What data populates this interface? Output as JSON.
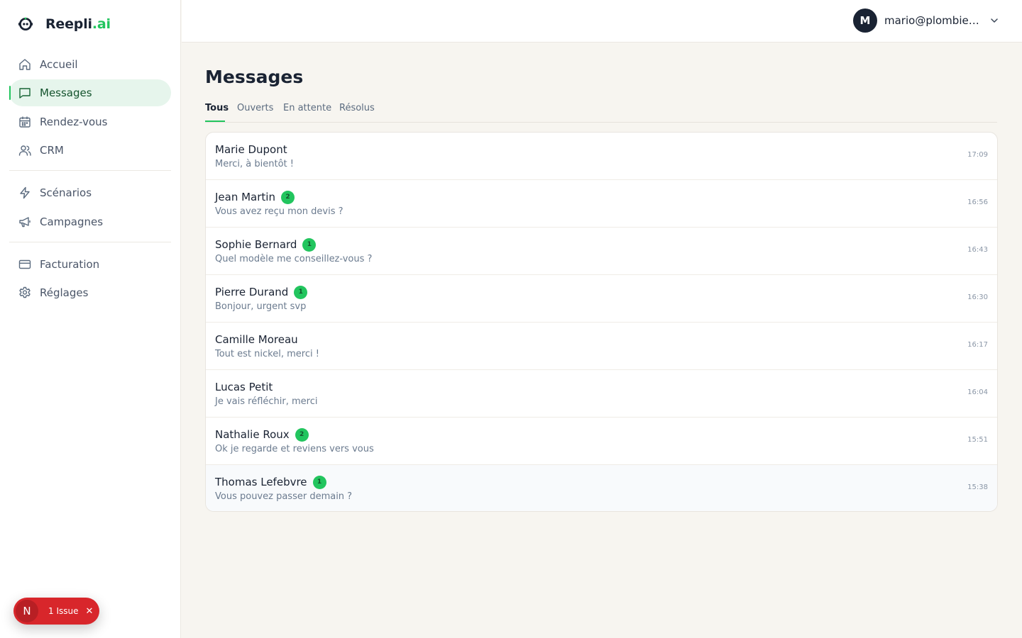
{
  "brand": {
    "name_main": "Reepli",
    "name_accent": ".ai"
  },
  "colors": {
    "accent": "#22c55e",
    "active_bg": "#e6f5ec",
    "dark": "#1a2333",
    "issue": "#d8262b"
  },
  "nav": [
    {
      "label": "Accueil",
      "icon": "home-icon",
      "active": false
    },
    {
      "label": "Messages",
      "icon": "message-icon",
      "active": true
    },
    {
      "label": "Rendez-vous",
      "icon": "calendar-icon",
      "active": false
    },
    {
      "label": "CRM",
      "icon": "users-icon",
      "active": false
    },
    {
      "label": "Scénarios",
      "icon": "bolt-icon",
      "active": false
    },
    {
      "label": "Campagnes",
      "icon": "megaphone-icon",
      "active": false
    },
    {
      "label": "Facturation",
      "icon": "credit-card-icon",
      "active": false
    },
    {
      "label": "Réglages",
      "icon": "gear-icon",
      "active": false
    }
  ],
  "issue": {
    "initial": "N",
    "label": "1 Issue"
  },
  "user": {
    "initial": "M",
    "email": "mario@plombier-..."
  },
  "page": {
    "title": "Messages"
  },
  "tabs": [
    {
      "label": "Tous",
      "active": true
    },
    {
      "label": "Ouverts",
      "active": false
    },
    {
      "label": "En attente",
      "active": false
    },
    {
      "label": "Résolus",
      "active": false
    }
  ],
  "messages": [
    {
      "name": "Marie Dupont",
      "preview": "Merci, à bientôt !",
      "time": "17:09",
      "unread": null
    },
    {
      "name": "Jean Martin",
      "preview": "Vous avez reçu mon devis ?",
      "time": "16:56",
      "unread": "2"
    },
    {
      "name": "Sophie Bernard",
      "preview": "Quel modèle me conseillez-vous ?",
      "time": "16:43",
      "unread": "1"
    },
    {
      "name": "Pierre Durand",
      "preview": "Bonjour, urgent svp",
      "time": "16:30",
      "unread": "1"
    },
    {
      "name": "Camille Moreau",
      "preview": "Tout est nickel, merci !",
      "time": "16:17",
      "unread": null
    },
    {
      "name": "Lucas Petit",
      "preview": "Je vais réfléchir, merci",
      "time": "16:04",
      "unread": null
    },
    {
      "name": "Nathalie Roux",
      "preview": "Ok je regarde et reviens vers vous",
      "time": "15:51",
      "unread": "2"
    },
    {
      "name": "Thomas Lefebvre",
      "preview": "Vous pouvez passer demain ?",
      "time": "15:38",
      "unread": "1"
    }
  ]
}
